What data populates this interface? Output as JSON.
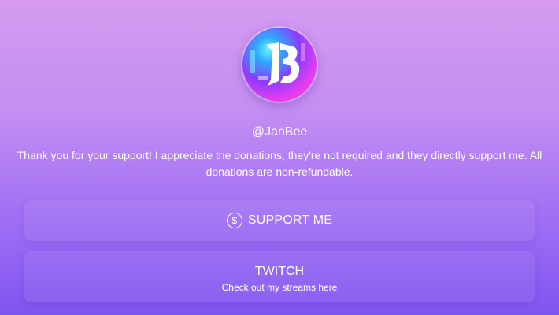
{
  "profile": {
    "handle": "@JanBee",
    "bio": "Thank you for your support! I appreciate the donations, they're not required and they directly support me. All donations are non-refundable.",
    "avatar_icon": "jb-logo-avatar"
  },
  "links": [
    {
      "label": "SUPPORT ME",
      "icon": "dollar-circle-icon"
    },
    {
      "label": "TWITCH",
      "subtitle": "Check out my streams here"
    }
  ],
  "colors": {
    "background_top": "#d69bf0",
    "background_bottom": "#7f55f0",
    "text": "#ffffff"
  }
}
